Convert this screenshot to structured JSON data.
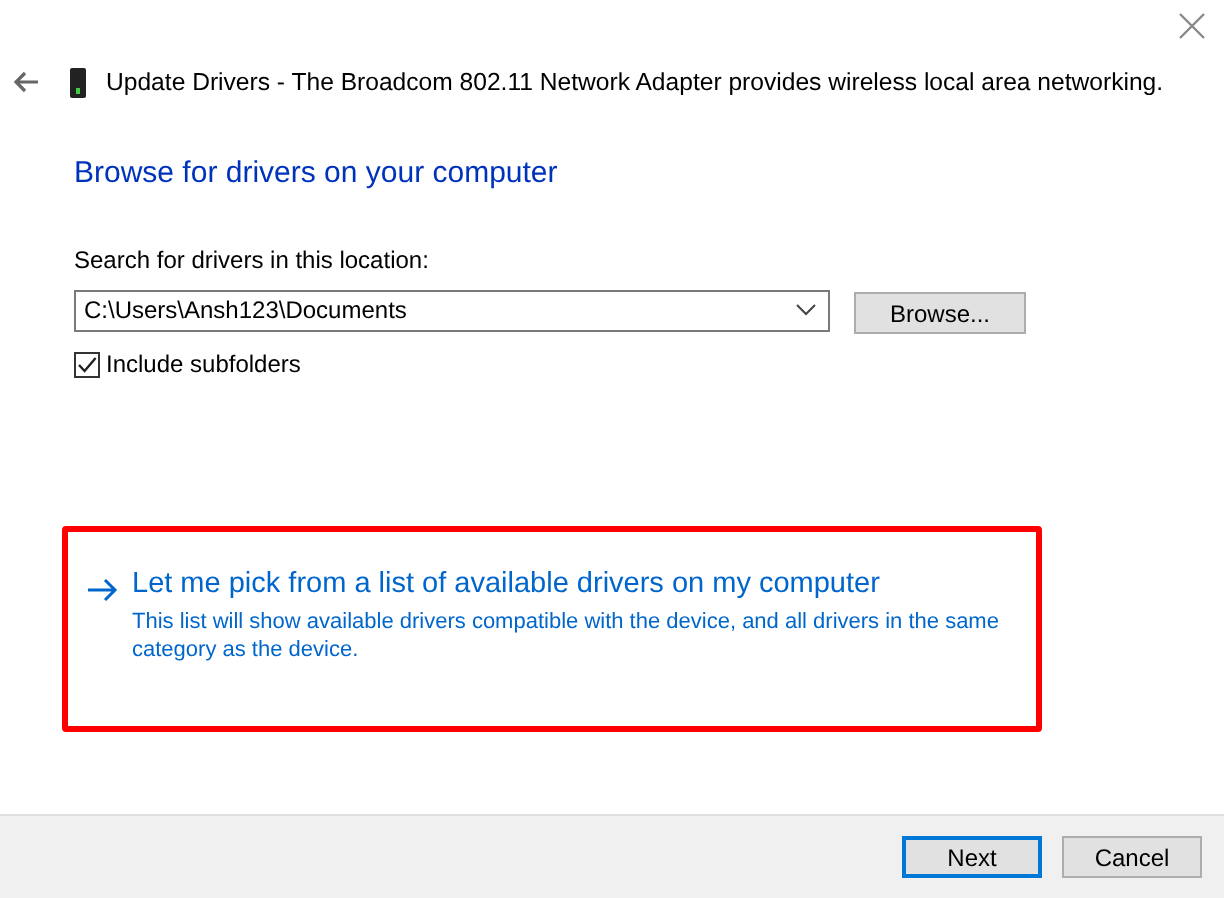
{
  "window": {
    "title": "Update Drivers - The Broadcom 802.11 Network Adapter provides wireless local area networking."
  },
  "heading": "Browse for drivers on your computer",
  "location": {
    "label": "Search for drivers in this location:",
    "value": "C:\\Users\\Ansh123\\Documents",
    "browse_button": "Browse..."
  },
  "include_subfolders": {
    "label": "Include subfolders",
    "checked": true
  },
  "pick_option": {
    "title": "Let me pick from a list of available drivers on my computer",
    "description": "This list will show available drivers compatible with the device, and all drivers in the same category as the device.",
    "highlighted": true
  },
  "buttons": [
    {
      "label": "Next",
      "default": true
    },
    {
      "label": "Cancel",
      "default": false
    }
  ]
}
